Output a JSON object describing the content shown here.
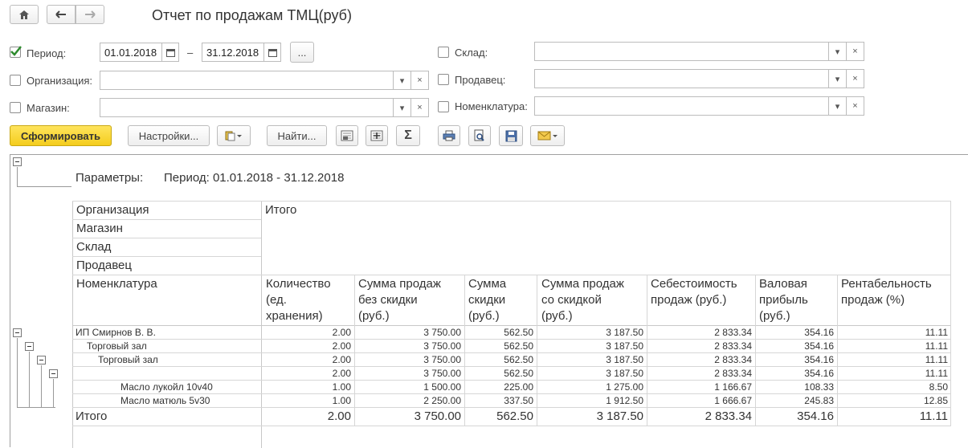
{
  "window": {
    "title": "Отчет по продажам ТМЦ(руб)"
  },
  "form": {
    "period": {
      "label": "Период:",
      "checked": true,
      "from": "01.01.2018",
      "dash": "–",
      "to": "31.12.2018",
      "more": "..."
    },
    "organization": {
      "label": "Организация:",
      "checked": false,
      "value": ""
    },
    "store": {
      "label": "Магазин:",
      "checked": false,
      "value": ""
    },
    "warehouse": {
      "label": "Склад:",
      "checked": false,
      "value": ""
    },
    "seller": {
      "label": "Продавец:",
      "checked": false,
      "value": ""
    },
    "nomenclature": {
      "label": "Номенклатура:",
      "checked": false,
      "value": ""
    }
  },
  "toolbar": {
    "generate": "Сформировать",
    "settings": "Настройки...",
    "find": "Найти...",
    "sum": "Σ"
  },
  "report": {
    "params_label": "Параметры:",
    "params_value": "Период: 01.01.2018 - 31.12.2018",
    "row_groups": [
      "Организация",
      "Магазин",
      "Склад",
      "Продавец",
      "Номенклатура"
    ],
    "total_header": "Итого",
    "columns": [
      [
        "Количество",
        "(ед.",
        "хранения)"
      ],
      [
        "Сумма продаж",
        "без скидки",
        "(руб.)"
      ],
      [
        "Сумма",
        "скидки",
        "(руб.)"
      ],
      [
        "Сумма продаж",
        "со скидкой",
        "(руб.)"
      ],
      [
        "Себестоимость",
        "продаж (руб.)",
        ""
      ],
      [
        "Валовая",
        "прибыль",
        "(руб.)"
      ],
      [
        "Рентабельность",
        "продаж (%)",
        ""
      ]
    ],
    "rows": [
      {
        "name": "ИП Смирнов В. В.",
        "values": [
          "2.00",
          "3 750.00",
          "562.50",
          "3 187.50",
          "2 833.34",
          "354.16",
          "11.11"
        ]
      },
      {
        "name": "Торговый зал",
        "values": [
          "2.00",
          "3 750.00",
          "562.50",
          "3 187.50",
          "2 833.34",
          "354.16",
          "11.11"
        ]
      },
      {
        "name": "Торговый зал",
        "values": [
          "2.00",
          "3 750.00",
          "562.50",
          "3 187.50",
          "2 833.34",
          "354.16",
          "11.11"
        ]
      },
      {
        "name": "",
        "values": [
          "2.00",
          "3 750.00",
          "562.50",
          "3 187.50",
          "2 833.34",
          "354.16",
          "11.11"
        ]
      },
      {
        "name": "Масло лукойл 10v40",
        "values": [
          "1.00",
          "1 500.00",
          "225.00",
          "1 275.00",
          "1 166.67",
          "108.33",
          "8.50"
        ]
      },
      {
        "name": "Масло матюль 5v30",
        "values": [
          "1.00",
          "2 250.00",
          "337.50",
          "1 912.50",
          "1 666.67",
          "245.83",
          "12.85"
        ]
      }
    ],
    "total": {
      "label": "Итого",
      "values": [
        "2.00",
        "3 750.00",
        "562.50",
        "3 187.50",
        "2 833.34",
        "354.16",
        "11.11"
      ]
    }
  },
  "colors": {
    "accent": "#f4cd1d",
    "check": "#2e8b2e"
  }
}
